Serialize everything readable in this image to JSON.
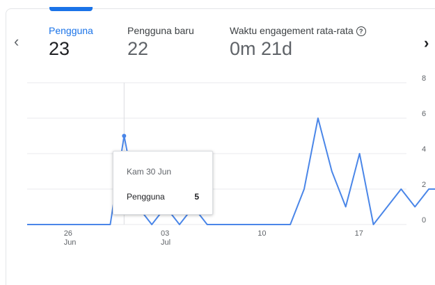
{
  "metrics": [
    {
      "label": "Pengguna",
      "value": "23"
    },
    {
      "label": "Pengguna baru",
      "value": "22"
    },
    {
      "label": "Waktu engagement rata-rata",
      "value": "0m 21d"
    }
  ],
  "nav": {
    "prev_icon": "chevron-left-icon",
    "next_icon": "chevron-right-icon"
  },
  "help_icon": "question-circle-icon",
  "tooltip": {
    "date": "Kam 30 Jun",
    "series": "Pengguna",
    "value": "5"
  },
  "colors": {
    "accent": "#1a73e8",
    "line": "#4a86e8",
    "grid": "#e8eaed"
  },
  "chart_data": {
    "type": "line",
    "x": [
      "Jun 23",
      "Jun 24",
      "Jun 25",
      "Jun 26",
      "Jun 27",
      "Jun 28",
      "Jun 29",
      "Jun 30",
      "Jul 1",
      "Jul 2",
      "Jul 3",
      "Jul 4",
      "Jul 5",
      "Jul 6",
      "Jul 7",
      "Jul 8",
      "Jul 9",
      "Jul 10",
      "Jul 11",
      "Jul 12",
      "Jul 13",
      "Jul 14",
      "Jul 15",
      "Jul 16",
      "Jul 17",
      "Jul 18",
      "Jul 19",
      "Jul 20",
      "Jul 21",
      "Jul 22"
    ],
    "series": [
      {
        "values": [
          0,
          0,
          0,
          0,
          0,
          0,
          0,
          5,
          1,
          0,
          1,
          0,
          1,
          0,
          0,
          0,
          0,
          0,
          0,
          0,
          2,
          6,
          3,
          1,
          4,
          0,
          1,
          2,
          1,
          2,
          2,
          0
        ]
      }
    ],
    "x_ticks": [
      {
        "index": 3,
        "label": "26",
        "sublabel": "Jun"
      },
      {
        "index": 10,
        "label": "03",
        "sublabel": "Jul"
      },
      {
        "index": 17,
        "label": "10",
        "sublabel": ""
      },
      {
        "index": 24,
        "label": "17",
        "sublabel": ""
      }
    ],
    "y_ticks": [
      0,
      2,
      4,
      6,
      8
    ],
    "ylim": [
      0,
      8
    ],
    "grid": true,
    "highlight_index": 7
  }
}
